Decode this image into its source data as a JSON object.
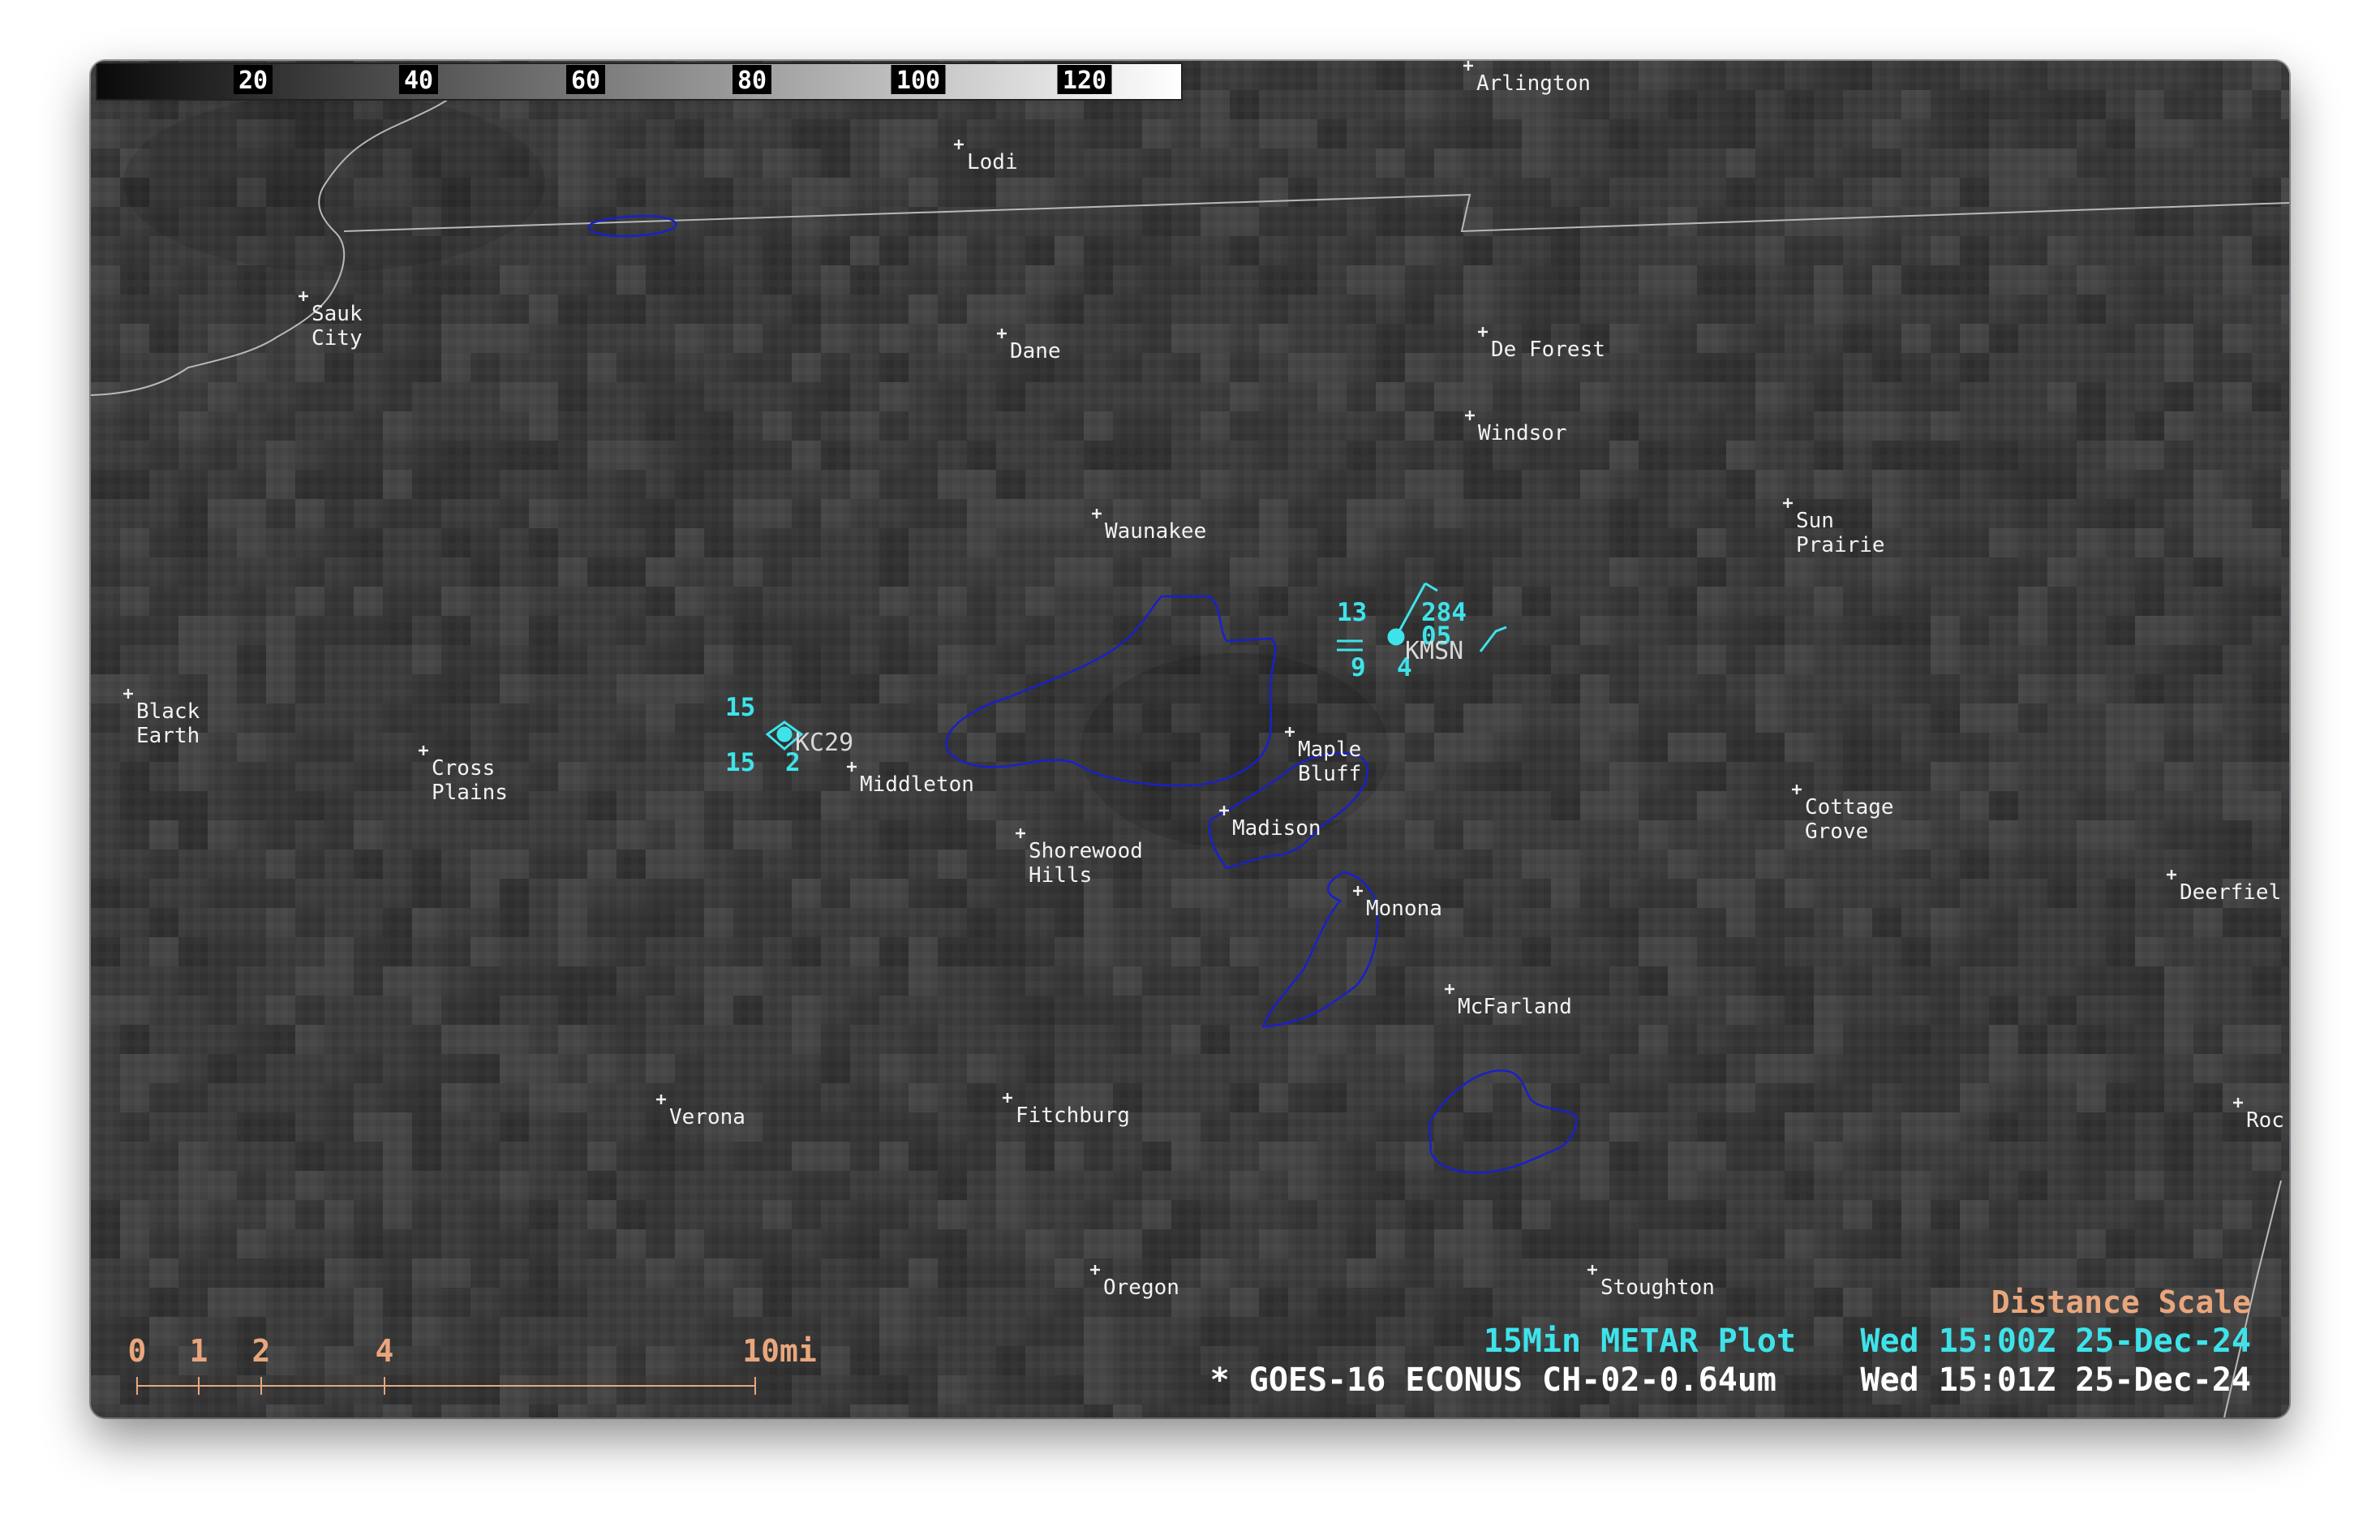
{
  "colorbar": {
    "ticks": [
      "20",
      "40",
      "60",
      "80",
      "100",
      "120"
    ]
  },
  "cities": [
    {
      "key": "arlington",
      "lines": [
        "Arlington"
      ]
    },
    {
      "key": "lodi",
      "lines": [
        "Lodi"
      ]
    },
    {
      "key": "sauk-city",
      "lines": [
        "Sauk",
        "City"
      ]
    },
    {
      "key": "dane",
      "lines": [
        "Dane"
      ]
    },
    {
      "key": "de-forest",
      "lines": [
        "De Forest"
      ]
    },
    {
      "key": "windsor",
      "lines": [
        "Windsor"
      ]
    },
    {
      "key": "waunakee",
      "lines": [
        "Waunakee"
      ]
    },
    {
      "key": "sun-prairie",
      "lines": [
        "Sun",
        "Prairie"
      ]
    },
    {
      "key": "black-earth",
      "lines": [
        "Black",
        "Earth"
      ]
    },
    {
      "key": "cross-plains",
      "lines": [
        "Cross",
        "Plains"
      ]
    },
    {
      "key": "middleton",
      "lines": [
        "Middleton"
      ]
    },
    {
      "key": "maple-bluff",
      "lines": [
        "Maple",
        "Bluff"
      ]
    },
    {
      "key": "madison",
      "lines": [
        "Madison"
      ]
    },
    {
      "key": "shorewood-hills",
      "lines": [
        "Shorewood",
        "Hills"
      ]
    },
    {
      "key": "cottage-grove",
      "lines": [
        "Cottage",
        "Grove"
      ]
    },
    {
      "key": "monona",
      "lines": [
        "Monona"
      ]
    },
    {
      "key": "deerfield",
      "lines": [
        "Deerfiel"
      ]
    },
    {
      "key": "mcfarland",
      "lines": [
        "McFarland"
      ]
    },
    {
      "key": "verona",
      "lines": [
        "Verona"
      ]
    },
    {
      "key": "fitchburg",
      "lines": [
        "Fitchburg"
      ]
    },
    {
      "key": "rock",
      "lines": [
        "Roc"
      ]
    },
    {
      "key": "oregon",
      "lines": [
        "Oregon"
      ]
    },
    {
      "key": "stoughton",
      "lines": [
        "Stoughton"
      ]
    }
  ],
  "stations": {
    "kc29": {
      "id": "KC29",
      "temp": "15",
      "dewpoint": "15",
      "visibility": "2"
    },
    "kmsn": {
      "id": "KMSN",
      "temp": "13",
      "dewpoint": "9",
      "pressure": "284",
      "visibility": "4",
      "vis_fraction": "05"
    }
  },
  "distance_scale": {
    "title": "Distance Scale",
    "ticks": [
      "0",
      "1",
      "2",
      "4",
      "10mi"
    ]
  },
  "footer": {
    "line1_left": "15Min METAR Plot",
    "line1_right": "Wed 15:00Z 25-Dec-24",
    "line2_left": "* GOES-16 ECONUS CH-02-0.64um",
    "line2_right": "Wed 15:01Z 25-Dec-24"
  },
  "colors": {
    "metar": "#3ee3ea",
    "lakes": "#1a20c8",
    "boundary": "#b8b8b8",
    "scale": "#e9a67c"
  }
}
